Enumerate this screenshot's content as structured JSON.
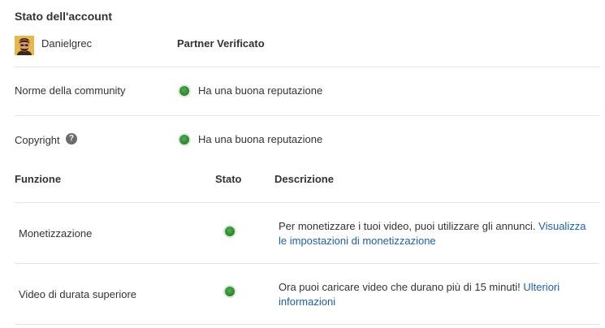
{
  "section_title": "Stato dell'account",
  "account": {
    "username": "Danielgrec",
    "partner_status": "Partner Verificato"
  },
  "community": {
    "label": "Norme della community",
    "status_text": "Ha una buona reputazione",
    "status_color": "#2e8b2e"
  },
  "copyright": {
    "label": "Copyright",
    "help_glyph": "?",
    "status_text": "Ha una buona reputazione",
    "status_color": "#2e8b2e"
  },
  "features_table": {
    "headers": {
      "feature": "Funzione",
      "status": "Stato",
      "description": "Descrizione"
    },
    "rows": [
      {
        "feature": "Monetizzazione",
        "status_color": "#2e8b2e",
        "description": "Per monetizzare i tuoi video, puoi utilizzare gli annunci.",
        "link_text": "Visualizza le impostazioni di monetizzazione"
      },
      {
        "feature": "Video di durata superiore",
        "status_color": "#2e8b2e",
        "description": "Ora puoi caricare video che durano più di 15 minuti!",
        "link_text": "Ulteriori informazioni"
      }
    ]
  },
  "colors": {
    "link": "#1a5fb4",
    "divider": "#e4e4e4",
    "good_status": "#2e8b2e"
  }
}
